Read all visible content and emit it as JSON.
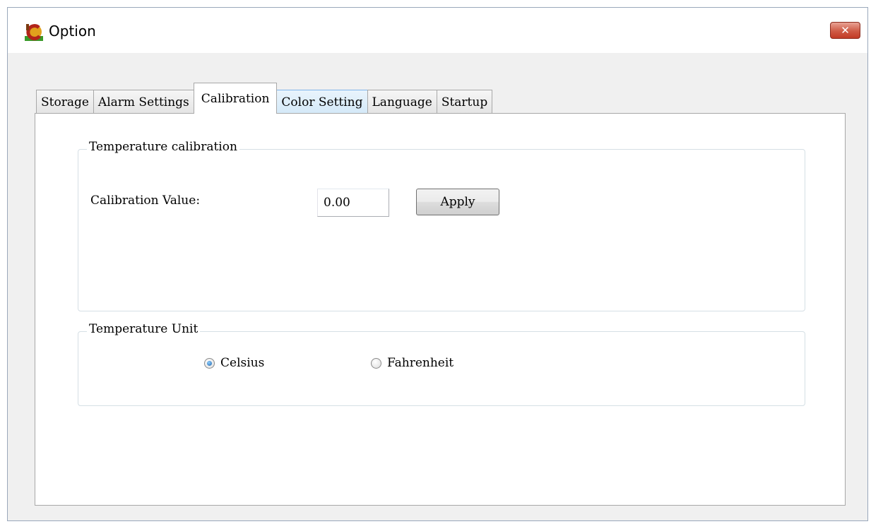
{
  "window": {
    "title": "Option",
    "close_symbol": "✕"
  },
  "tabs": [
    {
      "label": "Storage",
      "state": "normal"
    },
    {
      "label": "Alarm Settings",
      "state": "normal"
    },
    {
      "label": "Calibration",
      "state": "active"
    },
    {
      "label": "Color Setting",
      "state": "hover"
    },
    {
      "label": "Language",
      "state": "normal"
    },
    {
      "label": "Startup",
      "state": "normal"
    }
  ],
  "calibration_group": {
    "legend": "Temperature calibration",
    "value_label": "Calibration Value:",
    "value": "0.00",
    "apply_label": "Apply"
  },
  "unit_group": {
    "legend": "Temperature Unit",
    "options": [
      {
        "label": "Celsius",
        "checked": true
      },
      {
        "label": "Fahrenheit",
        "checked": false
      }
    ]
  },
  "colors": {
    "accent": "#1d5fa8",
    "close_button": "#c23b26",
    "hover_tab": "#d4e9f8"
  }
}
